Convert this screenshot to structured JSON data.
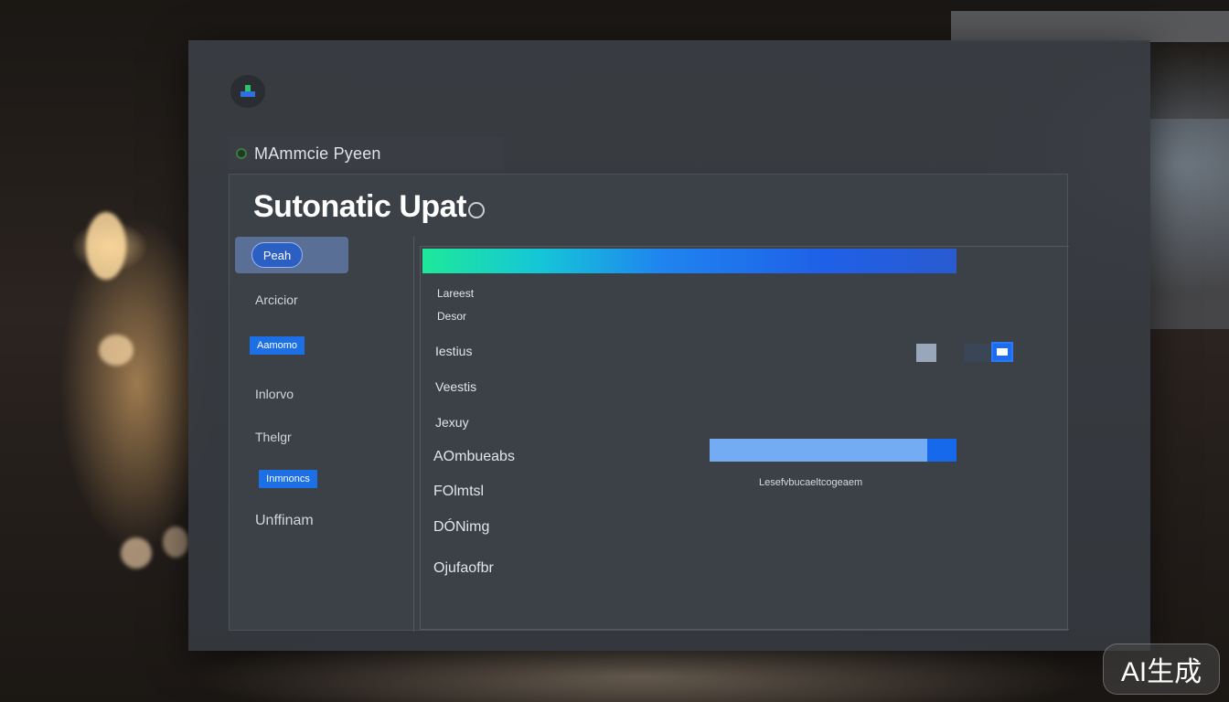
{
  "window": {
    "logo_icon": "app-logo-icon",
    "title_strip_label": "MAmmcie Pyeen",
    "title": "Sutonatic Upat"
  },
  "sidebar": {
    "items": [
      {
        "label": "Peah",
        "style": "pill"
      },
      {
        "label": "Arcicior",
        "style": "plain"
      },
      {
        "label": "Aamomo",
        "style": "blue-tag"
      },
      {
        "label": "Inlorvo",
        "style": "plain"
      },
      {
        "label": "Thelgr",
        "style": "plain"
      },
      {
        "label": "Inmnoncs",
        "style": "blue-tag"
      },
      {
        "label": "Unffinam",
        "style": "plain"
      }
    ]
  },
  "content": {
    "header_bar_colors": [
      "#1ee89a",
      "#1f84ef",
      "#2a5bd0"
    ],
    "lines": [
      "Lareest",
      "Desor",
      "Iestius",
      "Veestis",
      "Jexuy",
      "AOmbueabs",
      "FOlmtsl",
      "DÓNimg",
      "Ojufaofbr"
    ],
    "toggles": {
      "off_color": "#9aa7bb",
      "dark_color": "#3a4555",
      "on_color": "#1b6cf0",
      "checked": true
    },
    "progress": {
      "fraction": 0.88,
      "label": "Lesefvbucaeltcogeaem"
    }
  },
  "badge": {
    "label": "AI生成"
  },
  "colors": {
    "accent": "#1d6fe6",
    "panel": "#3c4047",
    "window": "#3a3e44"
  }
}
